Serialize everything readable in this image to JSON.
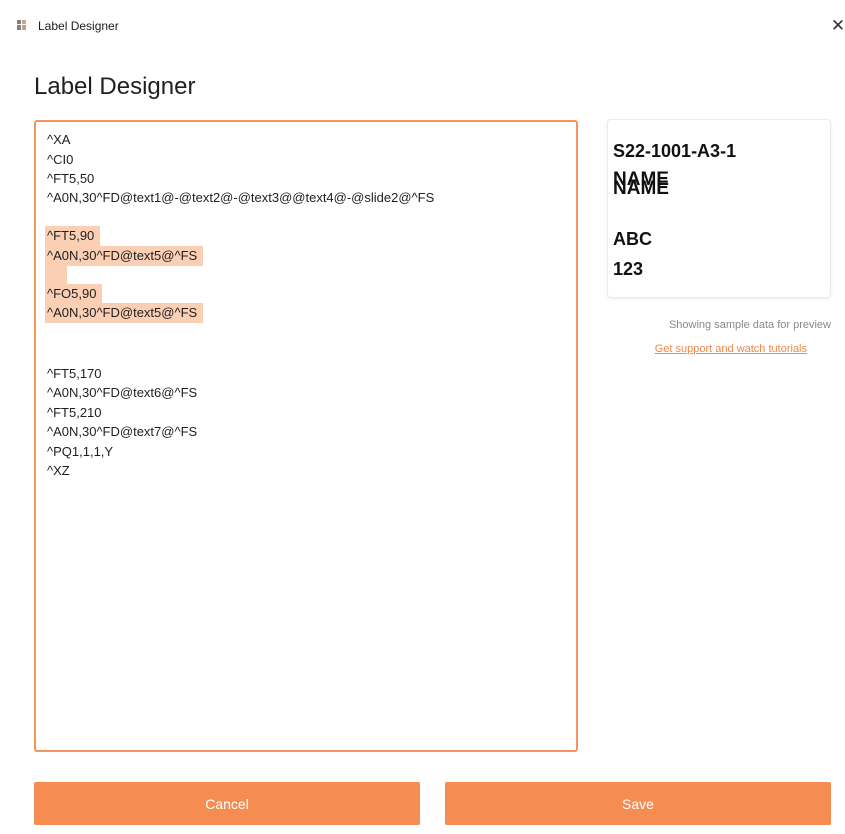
{
  "window": {
    "title": "Label Designer",
    "close_glyph": "✕"
  },
  "page": {
    "title": "Label Designer"
  },
  "editor": {
    "lines": [
      "^XA",
      "^CI0",
      "^FT5,50",
      "^A0N,30^FD@text1@-@text2@-@text3@@text4@-@slide2@^FS",
      "",
      "^FT5,90",
      "^A0N,30^FD@text5@^FS",
      "",
      "^FO5,90",
      "^A0N,30^FD@text5@^FS",
      "",
      "",
      "^FT5,170",
      "^A0N,30^FD@text6@^FS",
      "^FT5,210",
      "^A0N,30^FD@text7@^FS",
      "^PQ1,1,1,Y",
      "^XZ"
    ],
    "accent_color": "#f4955b",
    "highlight_color": "#fbcfb3"
  },
  "preview": {
    "lines": [
      "S22-1001-A3-1",
      "NAME",
      "NAME",
      "ABC",
      "123"
    ],
    "note": "Showing sample data for preview",
    "support_link": "Get support and watch tutorials"
  },
  "buttons": {
    "cancel": "Cancel",
    "save": "Save",
    "color": "#f58d52"
  }
}
